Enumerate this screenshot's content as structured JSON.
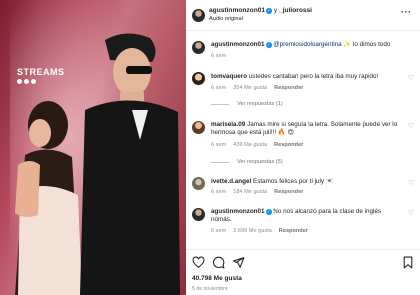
{
  "media": {
    "brand_text": "STREAMS"
  },
  "post": {
    "header_user": "agustinmonzon01",
    "header_sep": " y ",
    "header_coauthor": "_juliorossi",
    "header_sub": "Audio original",
    "caption_user": "agustinmonzon01",
    "caption_mention": "@premiosidoloargentina",
    "caption_text": " ✨ lo dimos todo",
    "caption_time": "6 sem"
  },
  "comments": [
    {
      "user": "tomvaquero",
      "text": "ustedes cantaban pero la letra iba muy rapido!",
      "time": "6 sem",
      "likes": "354 Me gusta",
      "reply": "Responder",
      "view_replies": "Ver respuestas (1)"
    },
    {
      "user": "marisela.09",
      "text": "Jamas mire si seguía la letra. Solamente puede ver lo hermosa que está juli!!! 🔥 😍",
      "time": "6 sem",
      "likes": "439 Me gusta",
      "reply": "Responder",
      "view_replies": "Ver respuestas (5)"
    },
    {
      "user": "ivette.d.angel",
      "text": "Estamos felices por ti july 💌",
      "time": "6 sem",
      "likes": "184 Me gusta",
      "reply": "Responder"
    },
    {
      "user": "agustinmonzon01",
      "text": "No nos alcanzó para la clase de inglés nomás.",
      "time": "6 sem",
      "likes": "2.699 Me gusta",
      "reply": "Responder"
    }
  ],
  "footer": {
    "likes": "40.798 Me gusta",
    "date": "5 de noviembre"
  },
  "icons": {
    "more": "more-options-icon",
    "heart": "heart-icon",
    "comment": "comment-icon",
    "share": "share-icon",
    "save": "bookmark-icon"
  },
  "colors": {
    "mention": "#00376b",
    "verified": "#0095f6",
    "muted": "#8e8e8e"
  }
}
